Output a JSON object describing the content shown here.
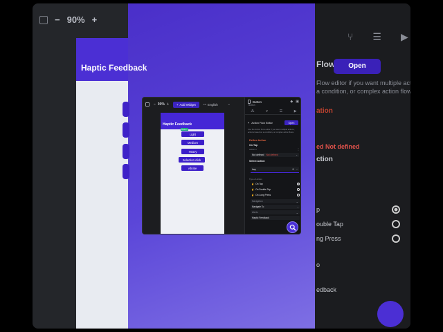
{
  "background": {
    "zoom_minus": "−",
    "zoom_value": "90%",
    "zoom_plus": "+",
    "phone_title": "Haptic Feedback",
    "panel_title": "Flow Editor",
    "panel_open": "Open",
    "panel_note_1": "Flow editor if you want multiple actions,",
    "panel_note_2": "a condition, or complex action flows.",
    "section_action": "ation",
    "not_defined": "ed  Not defined",
    "section_select": "ction",
    "tap": "p",
    "double_tap": "ouble Tap",
    "long_press": "ng Press",
    "to": "o",
    "feedback": "edback"
  },
  "toolbar": {
    "zoom_minus": "−",
    "zoom_value": "90%",
    "zoom_plus": "+",
    "add_widget": "Add Widget",
    "language": "English",
    "language_tag": "EN"
  },
  "phone": {
    "app_title": "Haptic Feedback",
    "selected_tag": "Button",
    "buttons": [
      "Light",
      "Medium",
      "Heavy",
      "Selection click",
      "vibrate"
    ]
  },
  "panel": {
    "widget_name": "Button",
    "widget_sub": "Button",
    "action_flow_editor": "Action Flow Editor",
    "open_label": "Open",
    "note": "Use the Action Flow editor if you want multiple actions, actions based on a condition, or complex action flows.",
    "define_action": "Define Action",
    "on_tap": "On Tap",
    "action_index": "Action 1",
    "not_defined_prefix": "Not defined",
    "not_defined_status": "Not defined",
    "select_action": "Select Action",
    "search_value": "hap",
    "type_of_action": "Type of Action",
    "triggers": [
      {
        "label": "On Tap",
        "selected": true
      },
      {
        "label": "On Double Tap",
        "selected": false
      },
      {
        "label": "On Long Press",
        "selected": false
      }
    ],
    "navigation": "Navigation",
    "navigate_to": "Navigate To",
    "alerts": "Alerts",
    "haptic_feedback": "Haptic Feedback"
  }
}
